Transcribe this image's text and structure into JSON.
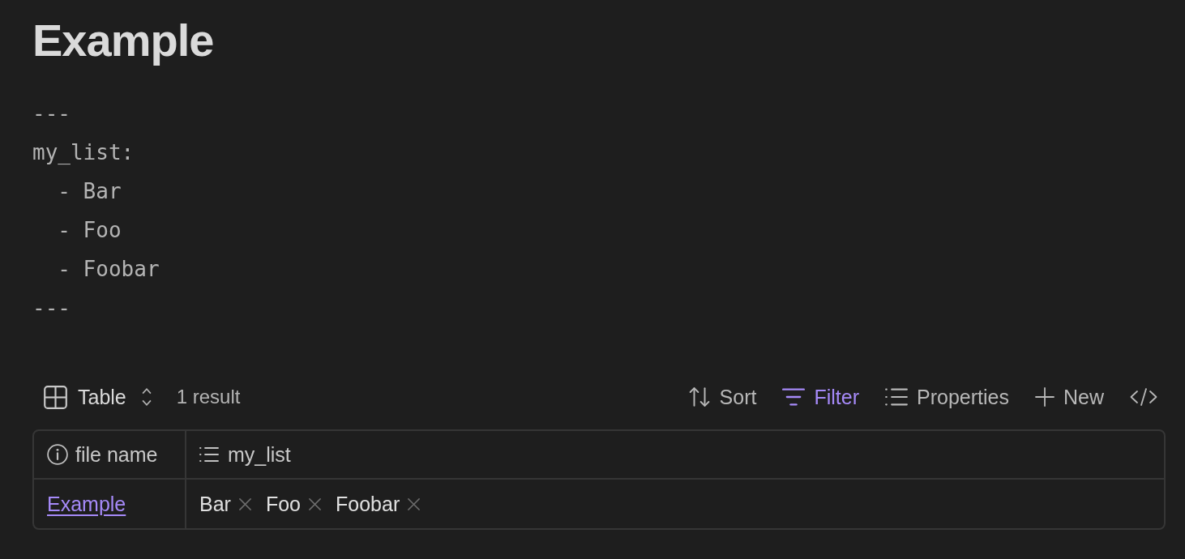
{
  "title": "Example",
  "frontmatter": {
    "lines": [
      "---",
      "my_list:",
      "  - Bar",
      "  - Foo",
      "  - Foobar",
      "---"
    ]
  },
  "toolbar": {
    "view": {
      "label": "Table"
    },
    "count": "1 result",
    "actions": [
      {
        "kind": "sort",
        "label": "Sort",
        "active": false
      },
      {
        "kind": "filter",
        "label": "Filter",
        "active": true
      },
      {
        "kind": "properties",
        "label": "Properties",
        "active": false
      },
      {
        "kind": "new",
        "label": "New",
        "active": false
      },
      {
        "kind": "code",
        "active": false
      }
    ]
  },
  "table": {
    "columns": [
      {
        "kind": "info",
        "label": "file name"
      },
      {
        "kind": "list",
        "label": "my_list"
      }
    ],
    "rows": [
      {
        "cells": [
          {
            "kind": "link",
            "text": "Example"
          },
          {
            "kind": "tags",
            "values": [
              "Bar",
              "Foo",
              "Foobar"
            ]
          }
        ]
      }
    ]
  }
}
